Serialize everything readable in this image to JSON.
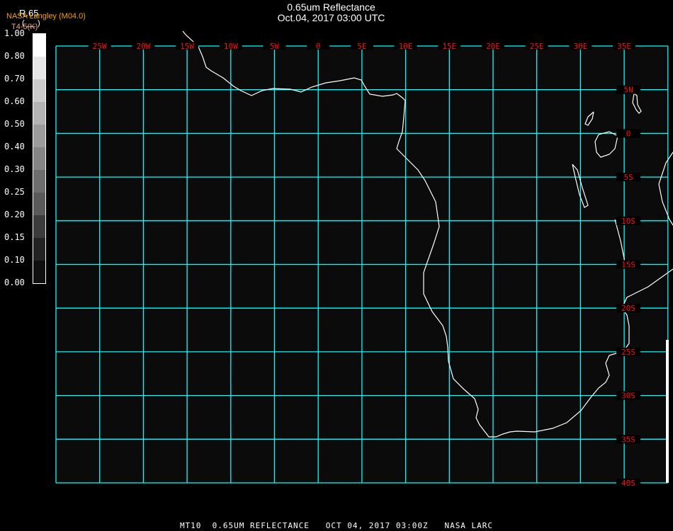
{
  "header": {
    "title": "0.65um Reflectance",
    "subtitle": "Oct.04, 2017 03:00 UTC",
    "band_label": "R.65",
    "producer": "NASA Langley (M04.0)",
    "paren": "( __ )",
    "unit_label": "T4-5(K)"
  },
  "colorbar": {
    "labels": [
      "1.00",
      "0.80",
      "0.70",
      "0.60",
      "0.50",
      "0.40",
      "0.30",
      "0.25",
      "0.20",
      "0.15",
      "0.10",
      "0.00"
    ],
    "colors": [
      "#ffffff",
      "#e6e6e6",
      "#cccccc",
      "#b3b3b3",
      "#9b9b9b",
      "#858585",
      "#6e6e6e",
      "#5a5a5a",
      "#3c3c3c",
      "#232323",
      "#0f0f0f"
    ]
  },
  "map": {
    "lon_range": [
      -30,
      40
    ],
    "lat_range": [
      -40,
      10
    ],
    "grid_color": "#00ffff",
    "coast_color": "#ffffff",
    "label_color": "#ff1010",
    "background": "#0b0b0b",
    "lon_labels": [
      {
        "lon": -25,
        "text": "25W"
      },
      {
        "lon": -20,
        "text": "20W"
      },
      {
        "lon": -15,
        "text": "15W"
      },
      {
        "lon": -10,
        "text": "10W"
      },
      {
        "lon": -5,
        "text": "5W"
      },
      {
        "lon": 0,
        "text": "0"
      },
      {
        "lon": 5,
        "text": "5E"
      },
      {
        "lon": 10,
        "text": "10E"
      },
      {
        "lon": 15,
        "text": "15E"
      },
      {
        "lon": 20,
        "text": "20E"
      },
      {
        "lon": 25,
        "text": "25E"
      },
      {
        "lon": 30,
        "text": "30E"
      },
      {
        "lon": 35,
        "text": "35E"
      }
    ],
    "lat_labels": [
      {
        "lat": 5,
        "text": "5N"
      },
      {
        "lat": 0,
        "text": "0"
      },
      {
        "lat": -5,
        "text": "5S"
      },
      {
        "lat": -10,
        "text": "10S"
      },
      {
        "lat": -15,
        "text": "15S"
      },
      {
        "lat": -20,
        "text": "20S"
      },
      {
        "lat": -25,
        "text": "25S"
      },
      {
        "lat": -30,
        "text": "30S"
      },
      {
        "lat": -35,
        "text": "35S"
      },
      {
        "lat": -40,
        "text": "40S"
      }
    ]
  },
  "footer": "MT10  0.65UM REFLECTANCE   OCT 04, 2017 03:00Z   NASA LARC"
}
